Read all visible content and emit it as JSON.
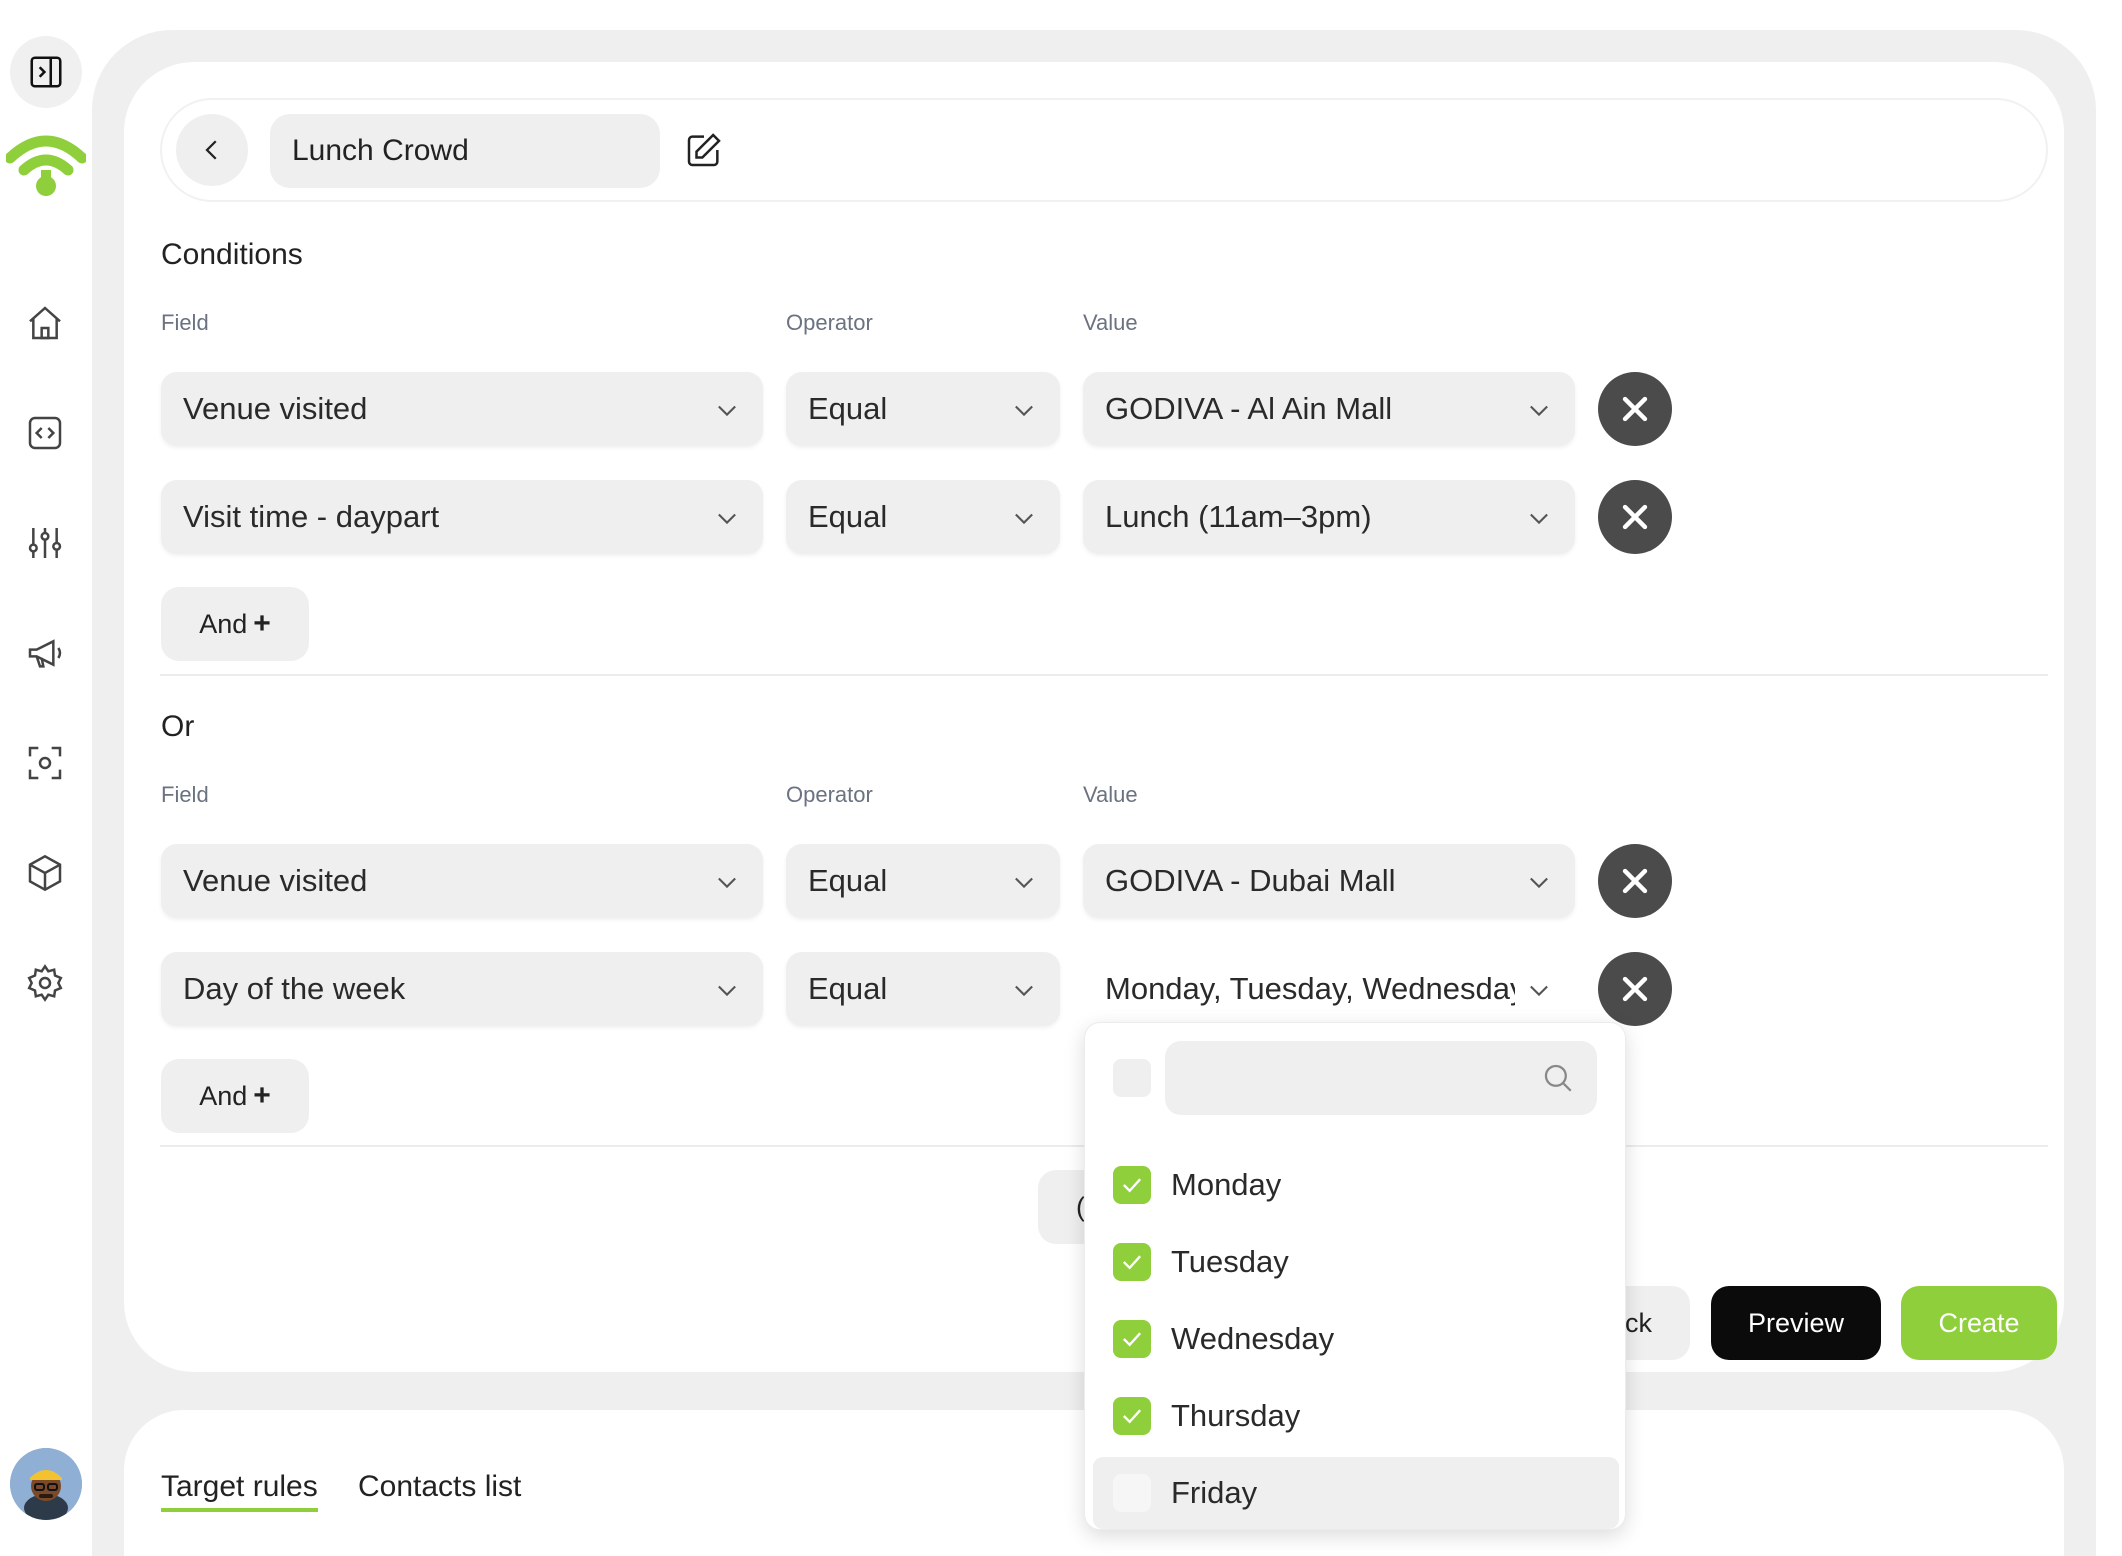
{
  "header": {
    "segment_name": "Lunch Crowd"
  },
  "groups": [
    {
      "title": "Conditions",
      "labels": {
        "field": "Field",
        "operator": "Operator",
        "value": "Value"
      },
      "rows": [
        {
          "field": "Venue visited",
          "operator": "Equal",
          "value": "GODIVA - Al Ain Mall"
        },
        {
          "field": "Visit time - daypart",
          "operator": "Equal",
          "value": "Lunch (11am–3pm)"
        }
      ],
      "and_label": "And"
    },
    {
      "title": "Or",
      "labels": {
        "field": "Field",
        "operator": "Operator",
        "value": "Value"
      },
      "rows": [
        {
          "field": "Venue visited",
          "operator": "Equal",
          "value": "GODIVA - Dubai Mall"
        },
        {
          "field": "Day of the week",
          "operator": "Equal",
          "value": "Monday, Tuesday, Wednesday"
        }
      ],
      "and_label": "And"
    }
  ],
  "footer": {
    "partial_or_button": "(",
    "partial_back_button": "ck",
    "preview_label": "Preview",
    "create_label": "Create"
  },
  "tabs": [
    {
      "label": "Target rules",
      "active": true
    },
    {
      "label": "Contacts list",
      "active": false
    }
  ],
  "dropdown": {
    "search_placeholder": "",
    "options": [
      {
        "label": "Monday",
        "checked": true
      },
      {
        "label": "Tuesday",
        "checked": true
      },
      {
        "label": "Wednesday",
        "checked": true
      },
      {
        "label": "Thursday",
        "checked": true
      },
      {
        "label": "Friday",
        "checked": false,
        "highlighted": true
      }
    ]
  },
  "colors": {
    "accent": "#8fcf3c",
    "dark": "#0b0b0b",
    "remove": "#4b4b4b",
    "field_bg": "#efefef"
  },
  "icons": [
    "sidebar-toggle-icon",
    "wifi-logo-icon",
    "home-icon",
    "code-icon",
    "sliders-icon",
    "megaphone-icon",
    "scan-icon",
    "cube-icon",
    "gear-icon",
    "chevron-left-icon",
    "edit-icon",
    "chevron-down-icon",
    "close-icon",
    "check-icon",
    "search-icon",
    "plus-icon"
  ]
}
